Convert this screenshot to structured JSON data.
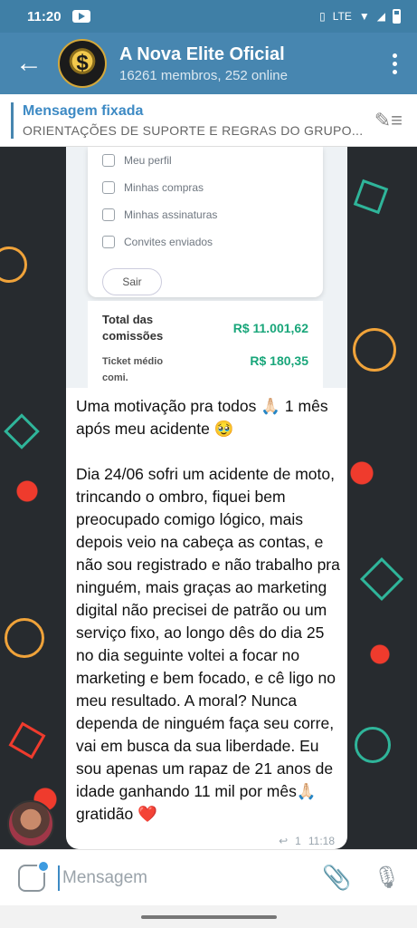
{
  "status_bar": {
    "time": "11:20",
    "network": "LTE"
  },
  "header": {
    "title": "A Nova Elite Oficial",
    "subtitle": "16261 membros, 252 online",
    "avatar_symbol": "$"
  },
  "pinned": {
    "label": "Mensagem fixada",
    "text": "ORIENTAÇÕES DE SUPORTE E REGRAS DO GRUPO..."
  },
  "screenshot": {
    "menu_items": [
      "Meu perfil",
      "Minhas compras",
      "Minhas assinaturas",
      "Convites enviados"
    ],
    "exit_label": "Sair",
    "total_label": "Total das comissões",
    "total_value": "R$ 11.001,62",
    "ticket_label": "Ticket médio comi.",
    "ticket_value": "R$ 180,35"
  },
  "message": {
    "para1": "Uma motivação pra todos 🙏🏻 1 mês após meu acidente 🥹",
    "para2": "Dia 24/06 sofri um acidente de moto, trincando o ombro, fiquei bem preocupado comigo lógico, mais depois veio na cabeça as contas, e não sou registrado e não trabalho pra ninguém, mais graças ao marketing digital não precisei de patrão ou um serviço fixo, ao longo dês do dia 25 no dia seguinte voltei a focar no marketing e bem focado, e cê ligo no meu resultado. A moral? Nunca dependa de ninguém faça seu corre, vai em busca da sua liberdade. Eu sou apenas um rapaz de 21 anos de idade ganhando 11 mil por mês🙏🏻 gratidão ❤️",
    "reply_count": "1",
    "time": "11:18"
  },
  "input": {
    "placeholder": "Mensagem"
  },
  "colors": {
    "header": "#4786b0",
    "accent": "#3d8ac4",
    "commission": "#19a67a"
  }
}
